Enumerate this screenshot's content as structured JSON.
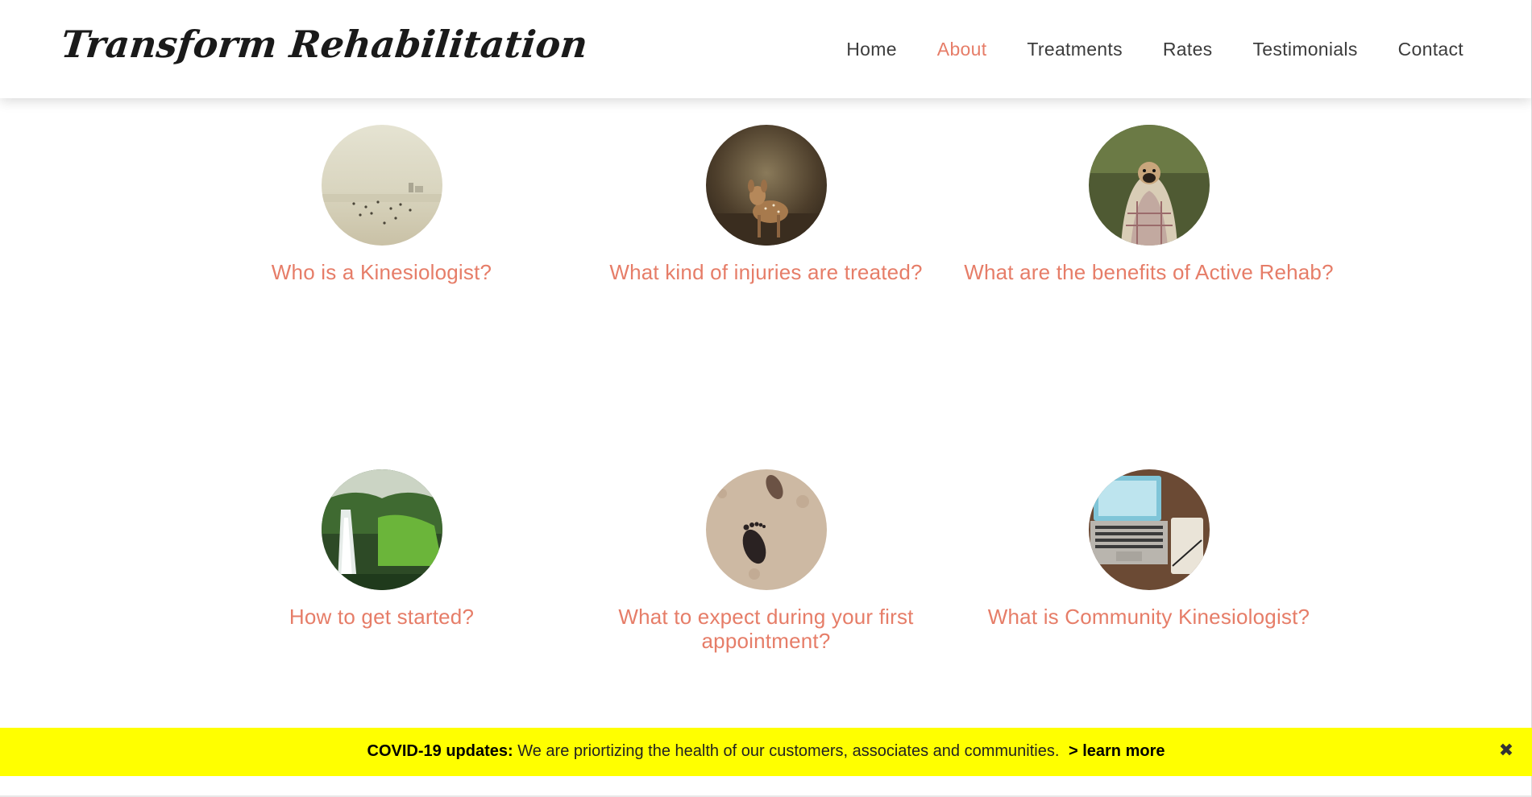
{
  "site": {
    "logo": "Transform Rehabilitation"
  },
  "nav": {
    "items": [
      {
        "label": "Home"
      },
      {
        "label": "About",
        "active": true
      },
      {
        "label": "Treatments"
      },
      {
        "label": "Rates"
      },
      {
        "label": "Testimonials"
      },
      {
        "label": "Contact"
      }
    ]
  },
  "cards": [
    {
      "title": "Who is a Kinesiologist?",
      "image": "beach-photo"
    },
    {
      "title": "What kind of injuries are treated?",
      "image": "fawn-photo"
    },
    {
      "title": "What are the benefits of Active Rehab?",
      "image": "pug-blanket-photo"
    },
    {
      "title": "How to get started?",
      "image": "waterfall-photo"
    },
    {
      "title": "What to expect during your first appointment?",
      "image": "footprints-photo"
    },
    {
      "title": "What is Community Kinesiologist?",
      "image": "laptop-desk-photo"
    }
  ],
  "banner": {
    "prefix": "COVID-19 updates:",
    "message": "We are priortizing the health of our customers, associates and communities.",
    "link": "> learn more",
    "close_icon": "close-icon"
  },
  "colors": {
    "accent": "#e67d68",
    "banner_bg": "#ffff00",
    "nav_text": "#3c3c3c"
  }
}
